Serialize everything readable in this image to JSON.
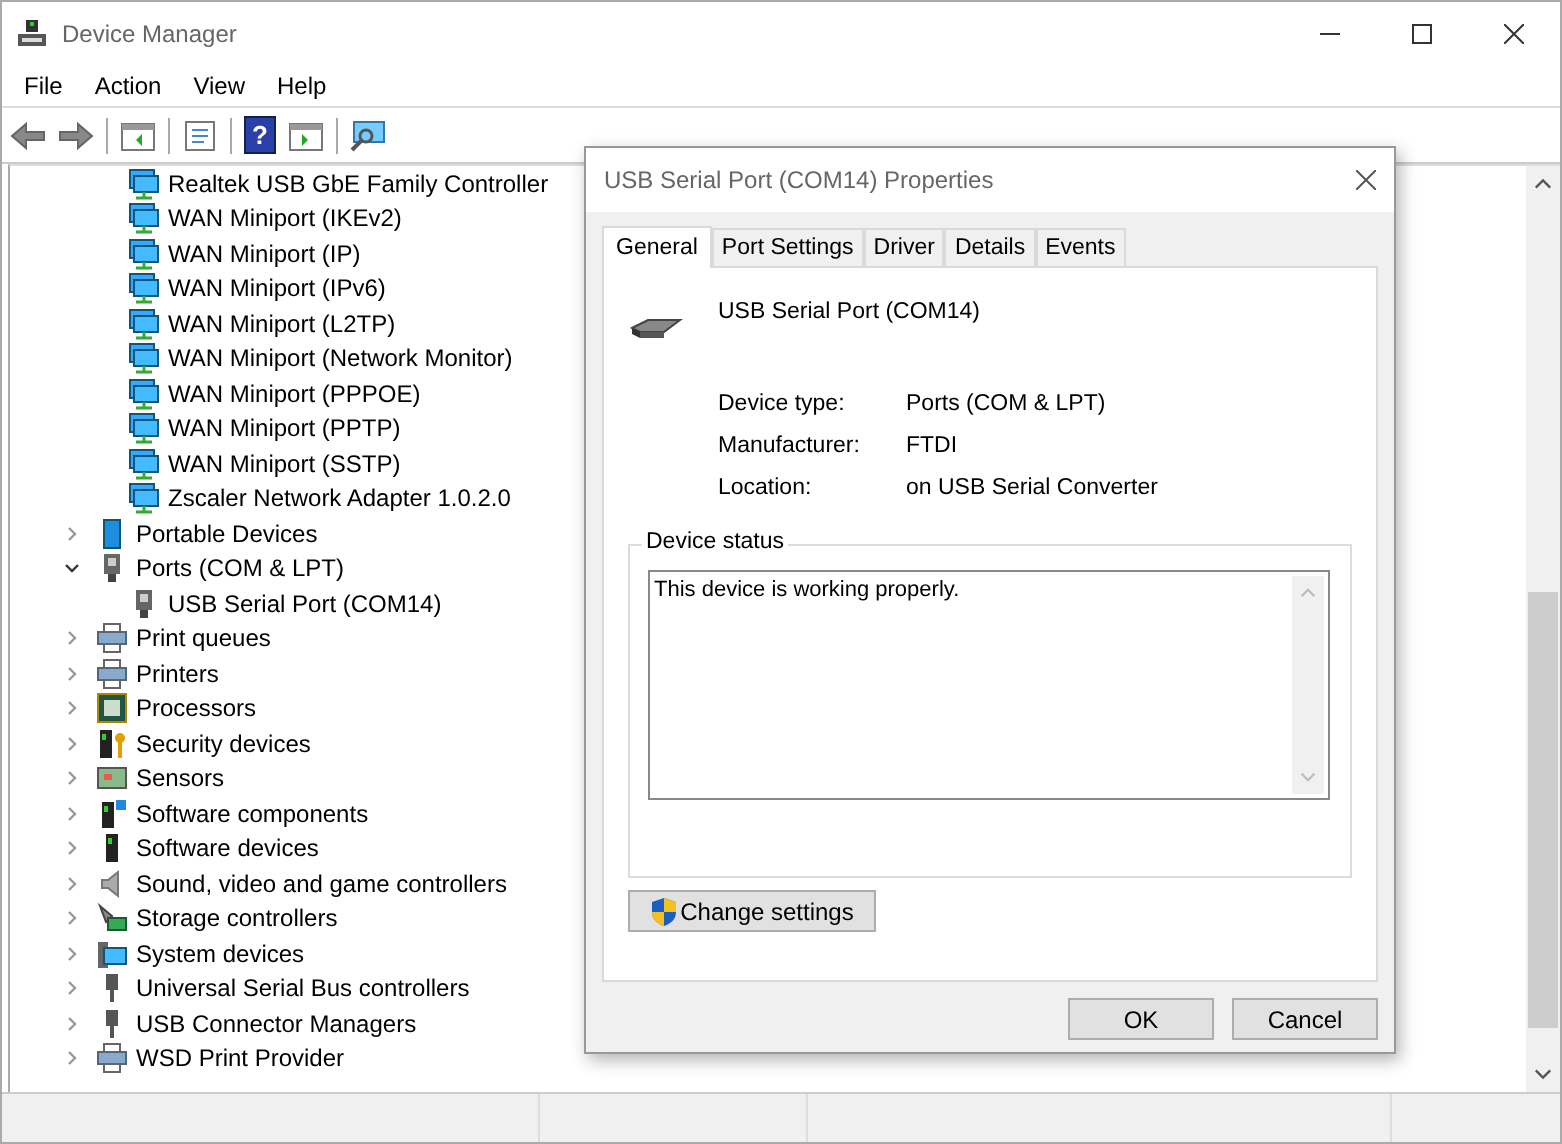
{
  "window": {
    "title": "Device Manager"
  },
  "menu": [
    "File",
    "Action",
    "View",
    "Help"
  ],
  "toolbar": [
    {
      "kind": "back"
    },
    {
      "kind": "forward"
    },
    {
      "kind": "sep"
    },
    {
      "kind": "panel"
    },
    {
      "kind": "sep"
    },
    {
      "kind": "props"
    },
    {
      "kind": "sep"
    },
    {
      "kind": "help",
      "glyph": "?"
    },
    {
      "kind": "update"
    },
    {
      "kind": "sep"
    },
    {
      "kind": "scan"
    }
  ],
  "tree_continued": [
    {
      "label": "Realtek USB GbE Family Controller"
    },
    {
      "label": "WAN Miniport (IKEv2)"
    },
    {
      "label": "WAN Miniport (IP)"
    },
    {
      "label": "WAN Miniport (IPv6)"
    },
    {
      "label": "WAN Miniport (L2TP)"
    },
    {
      "label": "WAN Miniport (Network Monitor)"
    },
    {
      "label": "WAN Miniport (PPPOE)"
    },
    {
      "label": "WAN Miniport (PPTP)"
    },
    {
      "label": "WAN Miniport (SSTP)"
    },
    {
      "label": "Zscaler Network Adapter 1.0.2.0"
    }
  ],
  "tree": [
    {
      "label": "Portable Devices",
      "kind": "portable",
      "expanded": false
    },
    {
      "label": "Ports (COM & LPT)",
      "kind": "port",
      "expanded": true,
      "children": [
        {
          "label": "USB Serial Port (COM14)"
        }
      ]
    },
    {
      "label": "Print queues",
      "kind": "printer",
      "expanded": false
    },
    {
      "label": "Printers",
      "kind": "printer",
      "expanded": false
    },
    {
      "label": "Processors",
      "kind": "processor",
      "expanded": false
    },
    {
      "label": "Security devices",
      "kind": "security",
      "expanded": false
    },
    {
      "label": "Sensors",
      "kind": "sensor",
      "expanded": false
    },
    {
      "label": "Software components",
      "kind": "swcomp",
      "expanded": false
    },
    {
      "label": "Software devices",
      "kind": "swdev",
      "expanded": false
    },
    {
      "label": "Sound, video and game controllers",
      "kind": "sound",
      "expanded": false
    },
    {
      "label": "Storage controllers",
      "kind": "storage",
      "expanded": false
    },
    {
      "label": "System devices",
      "kind": "system",
      "expanded": false
    },
    {
      "label": "Universal Serial Bus controllers",
      "kind": "usb",
      "expanded": false
    },
    {
      "label": "USB Connector Managers",
      "kind": "usb",
      "expanded": false
    },
    {
      "label": "WSD Print Provider",
      "kind": "printer",
      "expanded": false
    }
  ],
  "dialog": {
    "title": "USB Serial Port (COM14) Properties",
    "tabs": [
      {
        "label": "General",
        "selected": true
      },
      {
        "label": "Port Settings",
        "selected": false
      },
      {
        "label": "Driver",
        "selected": false
      },
      {
        "label": "Details",
        "selected": false
      },
      {
        "label": "Events",
        "selected": false
      }
    ],
    "device_name": "USB Serial Port (COM14)",
    "properties": [
      {
        "label": "Device type:",
        "value": "Ports (COM & LPT)"
      },
      {
        "label": "Manufacturer:",
        "value": "FTDI"
      },
      {
        "label": "Location:",
        "value": "on USB Serial Converter"
      }
    ],
    "status_group": "Device status",
    "status_text": "This device is working properly.",
    "change_button": "Change settings",
    "buttons": [
      "OK",
      "Cancel"
    ]
  }
}
